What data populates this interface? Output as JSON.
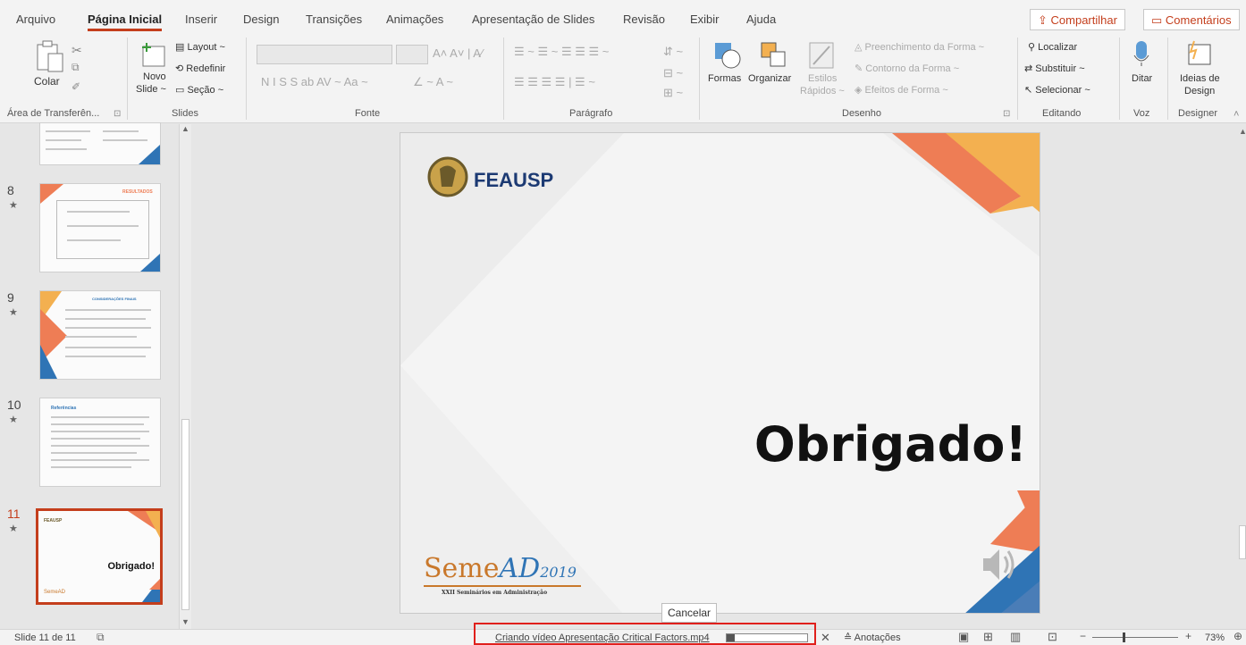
{
  "tabs": [
    "Arquivo",
    "Página Inicial",
    "Inserir",
    "Design",
    "Transições",
    "Animações",
    "Apresentação de Slides",
    "Revisão",
    "Exibir",
    "Ajuda"
  ],
  "active_tab": "Página Inicial",
  "share": "Compartilhar",
  "comments": "Comentários",
  "ribbon": {
    "clipboard": {
      "paste": "Colar",
      "label": "Área de Transferên..."
    },
    "slides": {
      "new_slide_1": "Novo",
      "new_slide_2": "Slide ~",
      "layout": "Layout ~",
      "reset": "Redefinir",
      "section": "Seção ~",
      "label": "Slides"
    },
    "font": {
      "label": "Fonte",
      "styles": "N I S S ab AV ~ Aa ~"
    },
    "paragraph": {
      "label": "Parágrafo"
    },
    "drawing": {
      "shapes": "Formas",
      "arrange": "Organizar",
      "quick_styles_1": "Estilos",
      "quick_styles_2": "Rápidos ~",
      "fill": "Preenchimento da Forma ~",
      "outline": "Contorno da Forma ~",
      "effects": "Efeitos de Forma ~",
      "label": "Desenho"
    },
    "editing": {
      "find": "Localizar",
      "replace": "Substituir ~",
      "select": "Selecionar ~",
      "label": "Editando"
    },
    "voice": {
      "dictate": "Ditar",
      "label": "Voz"
    },
    "designer": {
      "ideas_1": "Ideias de",
      "ideas_2": "Design",
      "label": "Designer"
    }
  },
  "thumbnails": [
    {
      "num": "8",
      "title": "RESULTADOS"
    },
    {
      "num": "9",
      "title": "CONSIDERAÇÕES FINAIS"
    },
    {
      "num": "10",
      "title": "Referências"
    },
    {
      "num": "11",
      "title": "Obrigado!",
      "logo": "FEAUSP",
      "footer": "SemeAD"
    }
  ],
  "slide": {
    "logo": "FEAUSP",
    "heading": "Obrigado!",
    "footer_1": "Seme",
    "footer_2": "AD",
    "footer_year": "2019",
    "footer_sub": "XXII Seminários em Administração"
  },
  "tooltip": "Cancelar",
  "status": {
    "slide_count": "Slide 11 de 11",
    "progress_text": "Criando vídeo Apresentação Critical Factors.mp4",
    "progress": 0.1,
    "notes": "Anotações",
    "zoom": "73%"
  },
  "colors": {
    "accent": "#c43e1c",
    "slide_orange": "#ee7d55",
    "slide_yellow": "#f3b050",
    "slide_blue": "#2f74b5",
    "highlight": "#e0201c"
  }
}
